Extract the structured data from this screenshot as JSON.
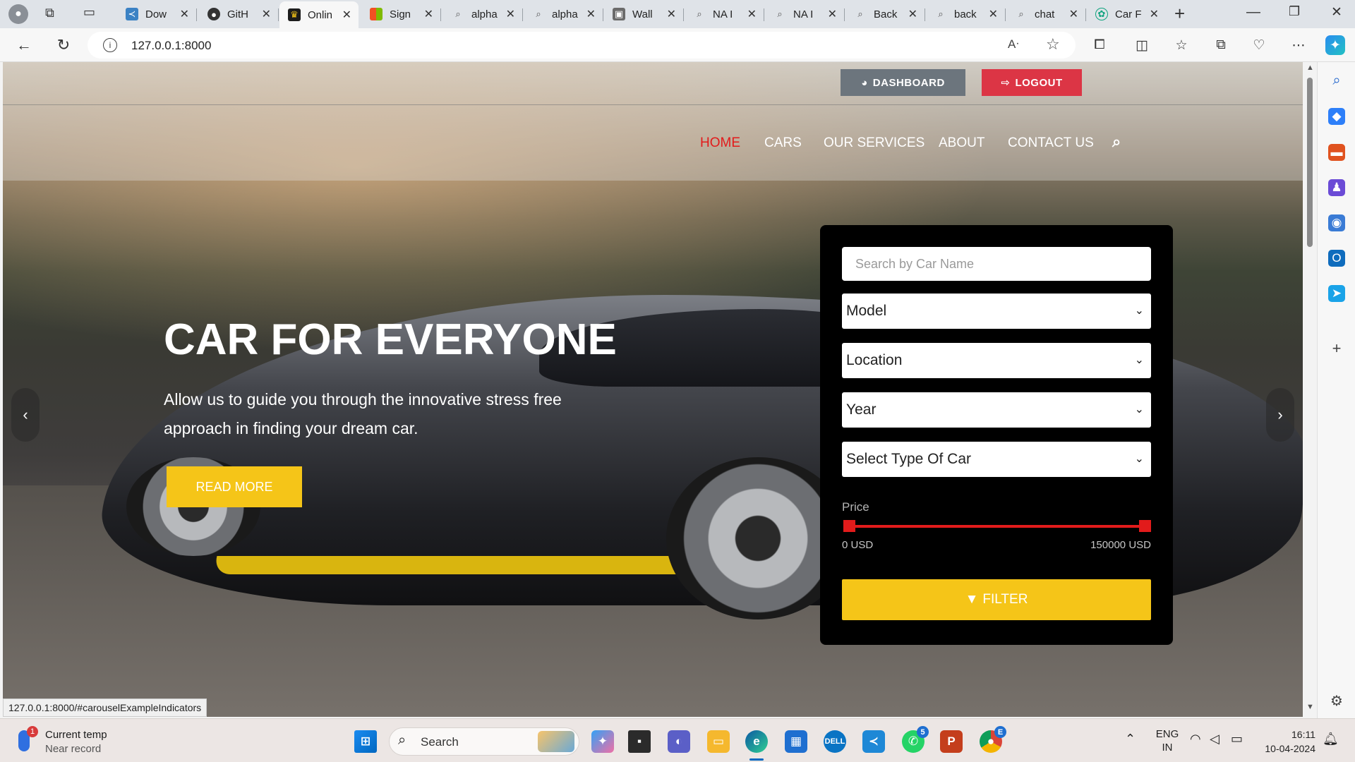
{
  "browser": {
    "tabs": [
      {
        "title": "Dow",
        "icon": "vscode-icon",
        "color": "#3b82c4"
      },
      {
        "title": "GitH",
        "icon": "github-icon",
        "color": "#333333"
      },
      {
        "title": "Onlin",
        "icon": "site-icon",
        "color": "#1c1c1c",
        "active": true
      },
      {
        "title": "Sign",
        "icon": "microsoft-icon",
        "color": "#e8a33a"
      },
      {
        "title": "alpha",
        "icon": "search-icon",
        "color": "#5a6f8a"
      },
      {
        "title": "alpha",
        "icon": "search-icon",
        "color": "#5a6f8a"
      },
      {
        "title": "Wall",
        "icon": "image-icon",
        "color": "#6b6b6b"
      },
      {
        "title": "NA I",
        "icon": "search-icon",
        "color": "#5a6f8a"
      },
      {
        "title": "NA I",
        "icon": "search-icon",
        "color": "#5a6f8a"
      },
      {
        "title": "Back",
        "icon": "search-icon",
        "color": "#5a6f8a"
      },
      {
        "title": "back",
        "icon": "search-icon",
        "color": "#5a6f8a"
      },
      {
        "title": "chat",
        "icon": "search-icon",
        "color": "#5a6f8a"
      },
      {
        "title": "Car F",
        "icon": "chatgpt-icon",
        "color": "#10a37f"
      }
    ],
    "url": "127.0.0.1:8000",
    "status_url": "127.0.0.1:8000/#carouselExampleIndicators"
  },
  "site": {
    "dashboard_label": "DASHBOARD",
    "logout_label": "LOGOUT",
    "nav": [
      {
        "label": "HOME",
        "active": true
      },
      {
        "label": "CARS"
      },
      {
        "label": "OUR SERVICES"
      },
      {
        "label": "ABOUT"
      },
      {
        "label": "CONTACT US"
      }
    ],
    "hero": {
      "title": "CAR FOR EVERYONE",
      "subtitle": "Allow us to guide you through the innovative stress free approach in finding your dream car.",
      "read_more": "READ MORE"
    },
    "filter": {
      "search_placeholder": "Search by Car Name",
      "model": "Model",
      "location": "Location",
      "year": "Year",
      "type": "Select Type Of Car",
      "price_label": "Price",
      "price_min": "0 USD",
      "price_max": "150000 USD",
      "button": "FILTER"
    }
  },
  "taskbar": {
    "weather_title": "Current temp",
    "weather_sub": "Near record",
    "weather_badge": "1",
    "search_label": "Search",
    "lang": "ENG",
    "region": "IN",
    "time": "16:11",
    "date": "10-04-2024",
    "whatsapp_badge": "5",
    "chrome_badge": "E"
  },
  "colors": {
    "accent_yellow": "#f5c518",
    "accent_red": "#e21b1b",
    "dashboard_gray": "#6c757d",
    "logout_red": "#dc3545"
  }
}
